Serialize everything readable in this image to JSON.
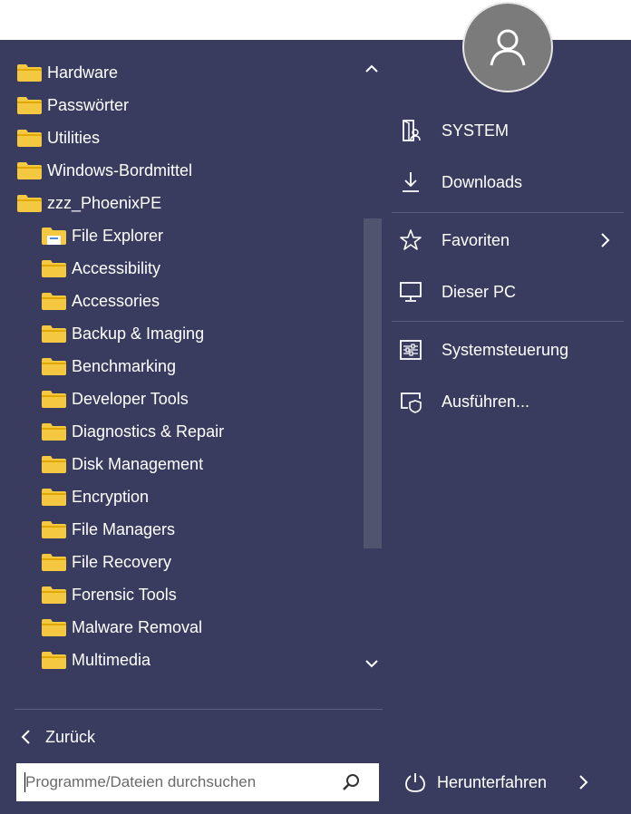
{
  "folders": [
    {
      "label": "Hardware"
    },
    {
      "label": "Passwörter"
    },
    {
      "label": "Utilities"
    },
    {
      "label": "Windows-Bordmittel"
    },
    {
      "label": "zzz_PhoenixPE"
    }
  ],
  "subfolders": [
    {
      "label": "File Explorer",
      "icon": "file-explorer-icon"
    },
    {
      "label": "Accessibility"
    },
    {
      "label": "Accessories"
    },
    {
      "label": "Backup & Imaging"
    },
    {
      "label": "Benchmarking"
    },
    {
      "label": "Developer Tools"
    },
    {
      "label": "Diagnostics & Repair"
    },
    {
      "label": "Disk Management"
    },
    {
      "label": "Encryption"
    },
    {
      "label": "File Managers"
    },
    {
      "label": "File Recovery"
    },
    {
      "label": "Forensic Tools"
    },
    {
      "label": "Malware Removal"
    },
    {
      "label": "Multimedia"
    }
  ],
  "back": {
    "label": "Zurück"
  },
  "search": {
    "placeholder": "Programme/Dateien durchsuchen"
  },
  "right": {
    "system": "SYSTEM",
    "downloads": "Downloads",
    "favoriten": "Favoriten",
    "dieser_pc": "Dieser PC",
    "systemsteuerung": "Systemsteuerung",
    "ausfuehren": "Ausführen...",
    "herunterfahren": "Herunterfahren"
  },
  "colors": {
    "panel": "#3a3c5f",
    "folder": "#f5c842",
    "text": "#ffffff"
  }
}
